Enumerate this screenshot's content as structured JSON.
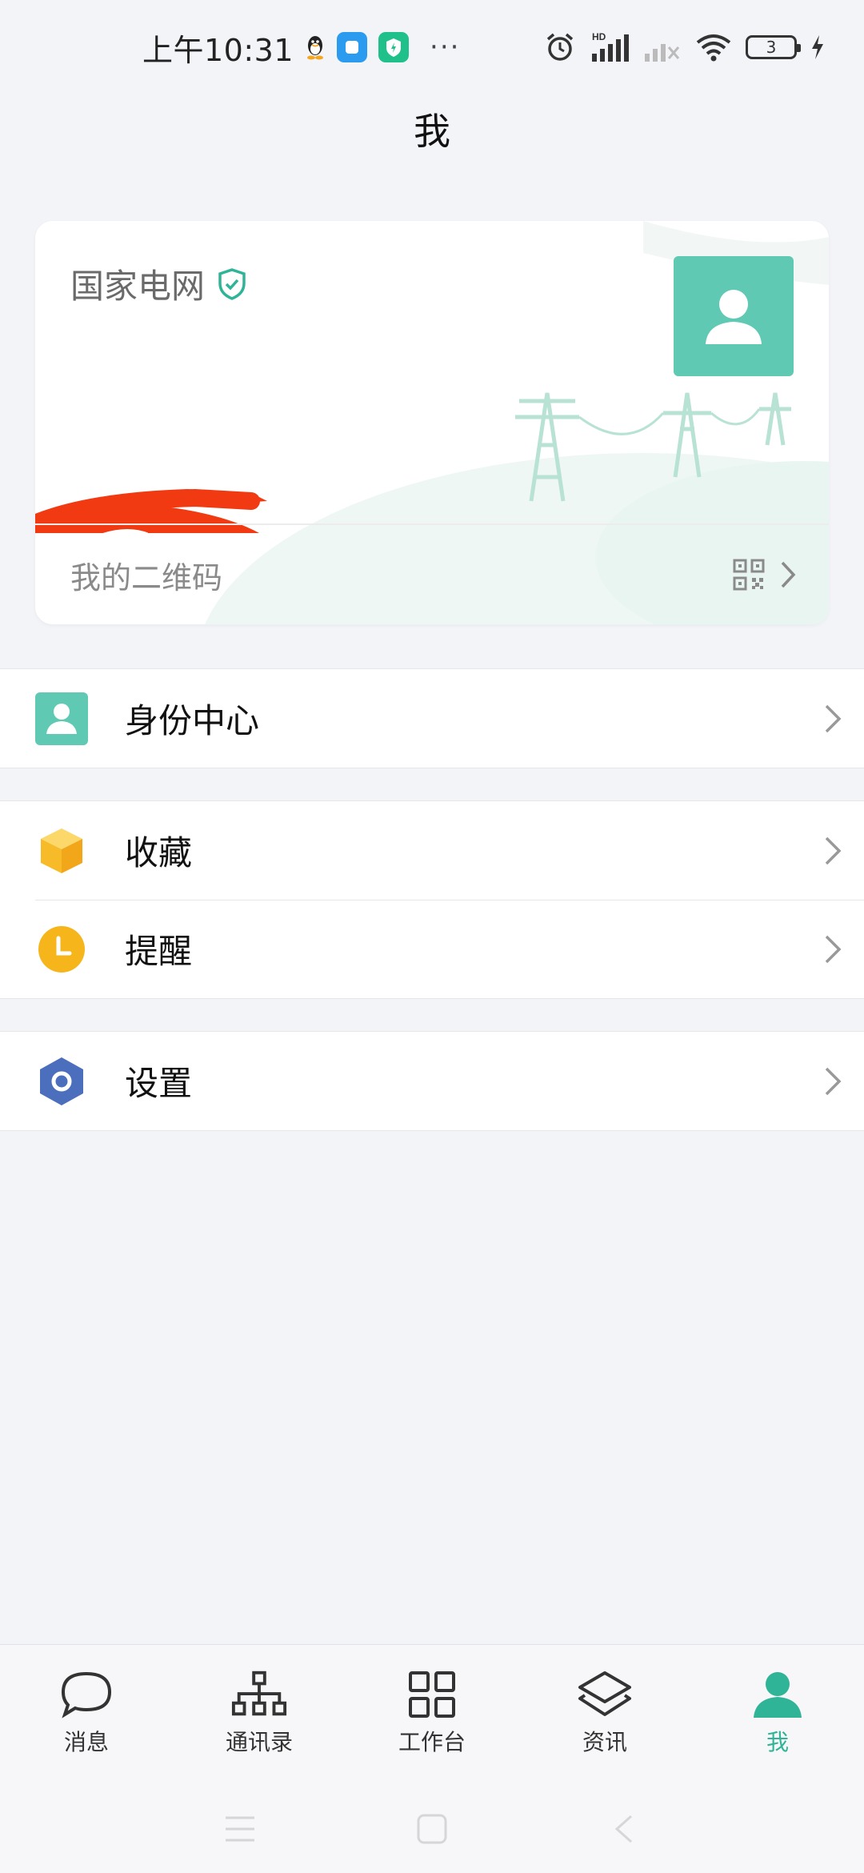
{
  "status_bar": {
    "time": "上午10:31",
    "battery_level": "3",
    "network_label": "HD"
  },
  "page_title": "我",
  "profile_card": {
    "organization": "国家电网",
    "qr_label": "我的二维码"
  },
  "menu_groups": [
    [
      {
        "label": "身份中心",
        "icon": "id-badge-icon",
        "color": "#5fc9b3"
      }
    ],
    [
      {
        "label": "收藏",
        "icon": "box-icon",
        "color": "#f7bb2a"
      },
      {
        "label": "提醒",
        "icon": "clock-icon",
        "color": "#f7b51c"
      }
    ],
    [
      {
        "label": "设置",
        "icon": "hexagon-gear-icon",
        "color": "#4b6fbd"
      }
    ]
  ],
  "bottom_nav": {
    "items": [
      {
        "label": "消息",
        "icon": "chat-bubble-icon",
        "active": false
      },
      {
        "label": "通讯录",
        "icon": "org-chart-icon",
        "active": false
      },
      {
        "label": "工作台",
        "icon": "grid-icon",
        "active": false
      },
      {
        "label": "资讯",
        "icon": "layers-icon",
        "active": false
      },
      {
        "label": "我",
        "icon": "person-icon",
        "active": true
      }
    ]
  },
  "colors": {
    "accent": "#2fb497",
    "avatar_bg": "#5fc9b3",
    "background": "#f3f4f8"
  }
}
